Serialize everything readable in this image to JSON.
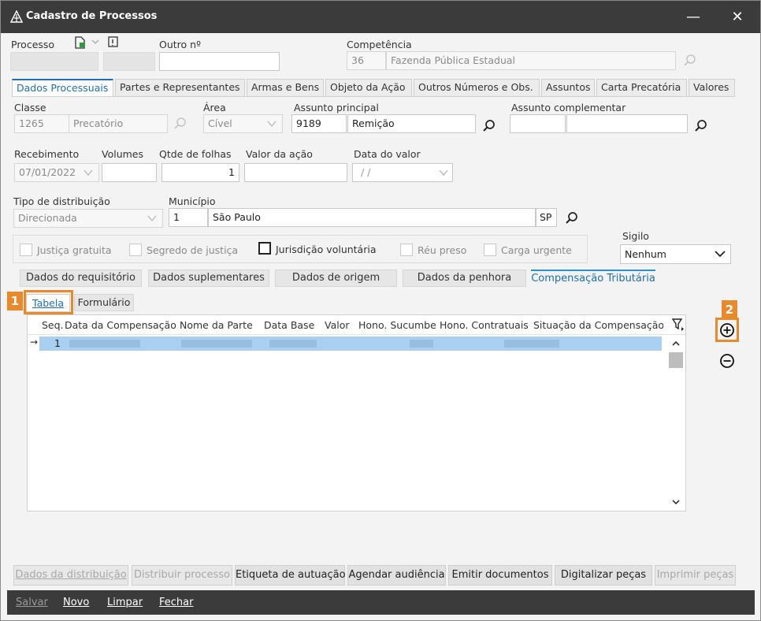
{
  "window": {
    "title": "Cadastro de Processos",
    "minimize": "—",
    "close": "✕"
  },
  "header": {
    "processo_label": "Processo",
    "outro_label": "Outro nº",
    "competencia_label": "Competência",
    "competencia_code": "36",
    "competencia_name": "Fazenda Pública Estadual"
  },
  "tabs": [
    "Dados Processuais",
    "Partes e Representantes",
    "Armas e Bens",
    "Objeto da Ação",
    "Outros Números e Obs.",
    "Assuntos",
    "Carta Precatória",
    "Valores"
  ],
  "form": {
    "classe_label": "Classe",
    "classe_code": "1265",
    "classe_name": "Precatório",
    "area_label": "Área",
    "area_value": "Cível",
    "assunto_principal_label": "Assunto principal",
    "assunto_principal_code": "9189",
    "assunto_principal_name": "Remição",
    "assunto_complementar_label": "Assunto complementar",
    "recebimento_label": "Recebimento",
    "recebimento_value": "07/01/2022",
    "volumes_label": "Volumes",
    "qtde_folhas_label": "Qtde de folhas",
    "qtde_folhas_value": "1",
    "valor_acao_label": "Valor da ação",
    "data_valor_label": "Data do valor",
    "data_valor_value": " /  /",
    "tipo_distribuicao_label": "Tipo de distribuição",
    "tipo_distribuicao_value": "Direcionada",
    "municipio_label": "Município",
    "municipio_code": "1",
    "municipio_name": "São Paulo",
    "municipio_uf": "SP",
    "sigilo_label": "Sigilo",
    "sigilo_value": "Nenhum"
  },
  "checkboxes": {
    "justica_gratuita": "Justiça gratuita",
    "segredo_justica": "Segredo de justiça",
    "jurisdicao_voluntaria": "Jurisdição voluntária",
    "reu_preso": "Réu preso",
    "carga_urgente": "Carga urgente"
  },
  "subtabs": [
    "Dados do requisitório",
    "Dados suplementares",
    "Dados de origem",
    "Dados da penhora",
    "Compensação Tributária"
  ],
  "view_tabs": {
    "tabela": "Tabela",
    "formulario": "Formulário"
  },
  "table": {
    "columns": [
      "Seq.",
      "Data da Compensação",
      "Nome da Parte",
      "Data Base",
      "Valor",
      "Hono. Sucumbe",
      "Hono. Contratuais",
      "Situação da Compensação"
    ],
    "rows": [
      {
        "seq": "1"
      }
    ],
    "row_indicator": "→"
  },
  "markers": {
    "one": "1",
    "two": "2"
  },
  "action_buttons": {
    "dados_distribuicao": "Dados da distribuição",
    "distribuir_processo": "Distribuir processo",
    "etiqueta_autuacao": "Etiqueta de autuação",
    "agendar_audiencia": "Agendar audiência",
    "emitir_documentos": "Emitir documentos",
    "digitalizar_pecas": "Digitalizar peças",
    "imprimir_pecas": "Imprimir peças"
  },
  "bottom_bar": {
    "salvar": "Salvar",
    "novo": "Novo",
    "limpar": "Limpar",
    "fechar": "Fechar"
  }
}
